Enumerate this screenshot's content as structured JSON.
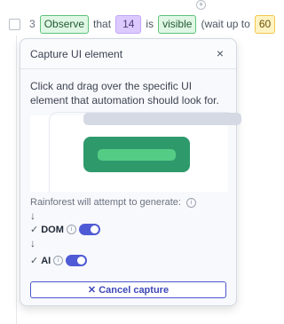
{
  "step": {
    "number": "3",
    "tokens": [
      {
        "text": "Observe",
        "style": "green"
      },
      {
        "text": "that",
        "style": "plain"
      },
      {
        "text": "14",
        "style": "purple"
      },
      {
        "text": "is",
        "style": "plain"
      },
      {
        "text": "visible",
        "style": "green"
      },
      {
        "text": "(wait up to",
        "style": "plain"
      },
      {
        "text": "60",
        "style": "yellow"
      }
    ]
  },
  "popover": {
    "title": "Capture UI element",
    "close_label": "×",
    "description": "Click and drag over the specific UI element that automation should look for.",
    "generate_text": "Rainforest will attempt to generate:",
    "info_glyph": "i",
    "arrow_glyph": "↓",
    "check_glyph": "✓",
    "options": [
      {
        "label": "DOM",
        "enabled": true
      },
      {
        "label": "AI",
        "enabled": true
      }
    ],
    "cancel_label": "✕ Cancel capture"
  },
  "colors": {
    "accent": "#4f5bd5",
    "preview_button": "#2e9a6c",
    "preview_button_inner": "#55cc85",
    "token_green": "#dff7e4",
    "token_purple": "#dcc9ff",
    "token_yellow": "#fff3c4"
  },
  "icons": {
    "add": "plus-icon",
    "close": "close-icon",
    "info": "info-icon",
    "arrow": "arrow-down-icon",
    "check": "check-icon"
  }
}
